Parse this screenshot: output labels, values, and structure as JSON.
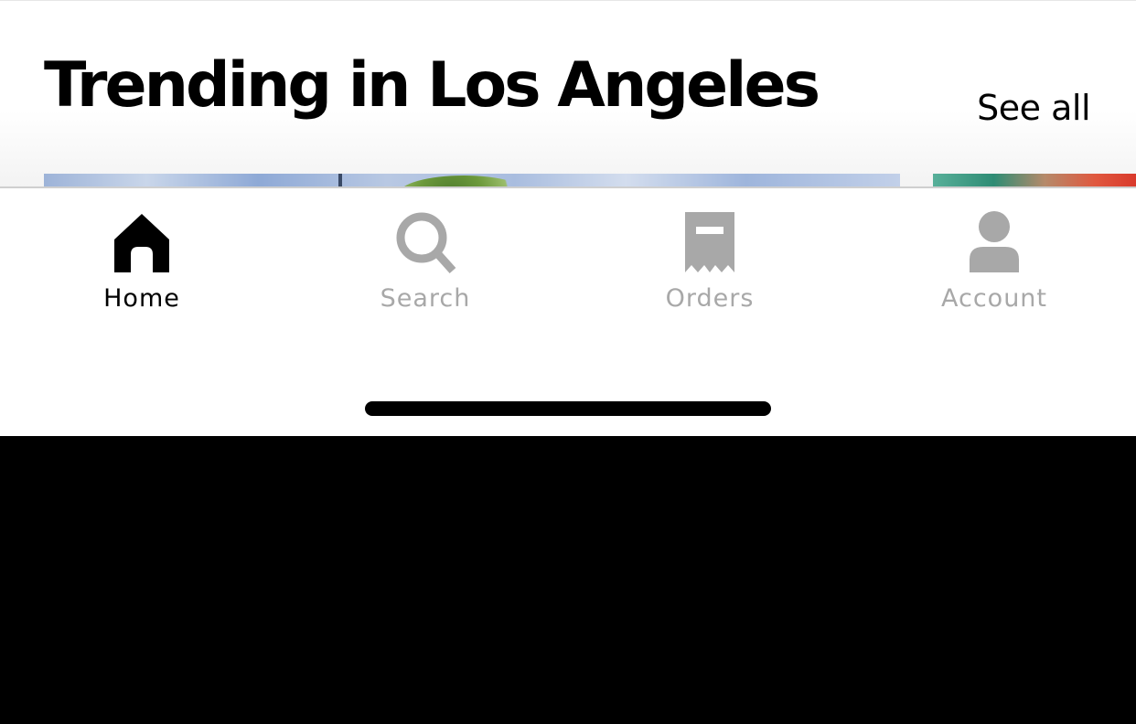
{
  "section": {
    "title": "Trending in Los Angeles",
    "see_all_label": "See all"
  },
  "tabbar": {
    "active_color": "#000000",
    "inactive_color": "#a8a8a8",
    "tabs": [
      {
        "label": "Home",
        "icon": "home-icon",
        "active": true
      },
      {
        "label": "Search",
        "icon": "search-icon",
        "active": false
      },
      {
        "label": "Orders",
        "icon": "receipt-icon",
        "active": false
      },
      {
        "label": "Account",
        "icon": "person-icon",
        "active": false
      }
    ]
  }
}
